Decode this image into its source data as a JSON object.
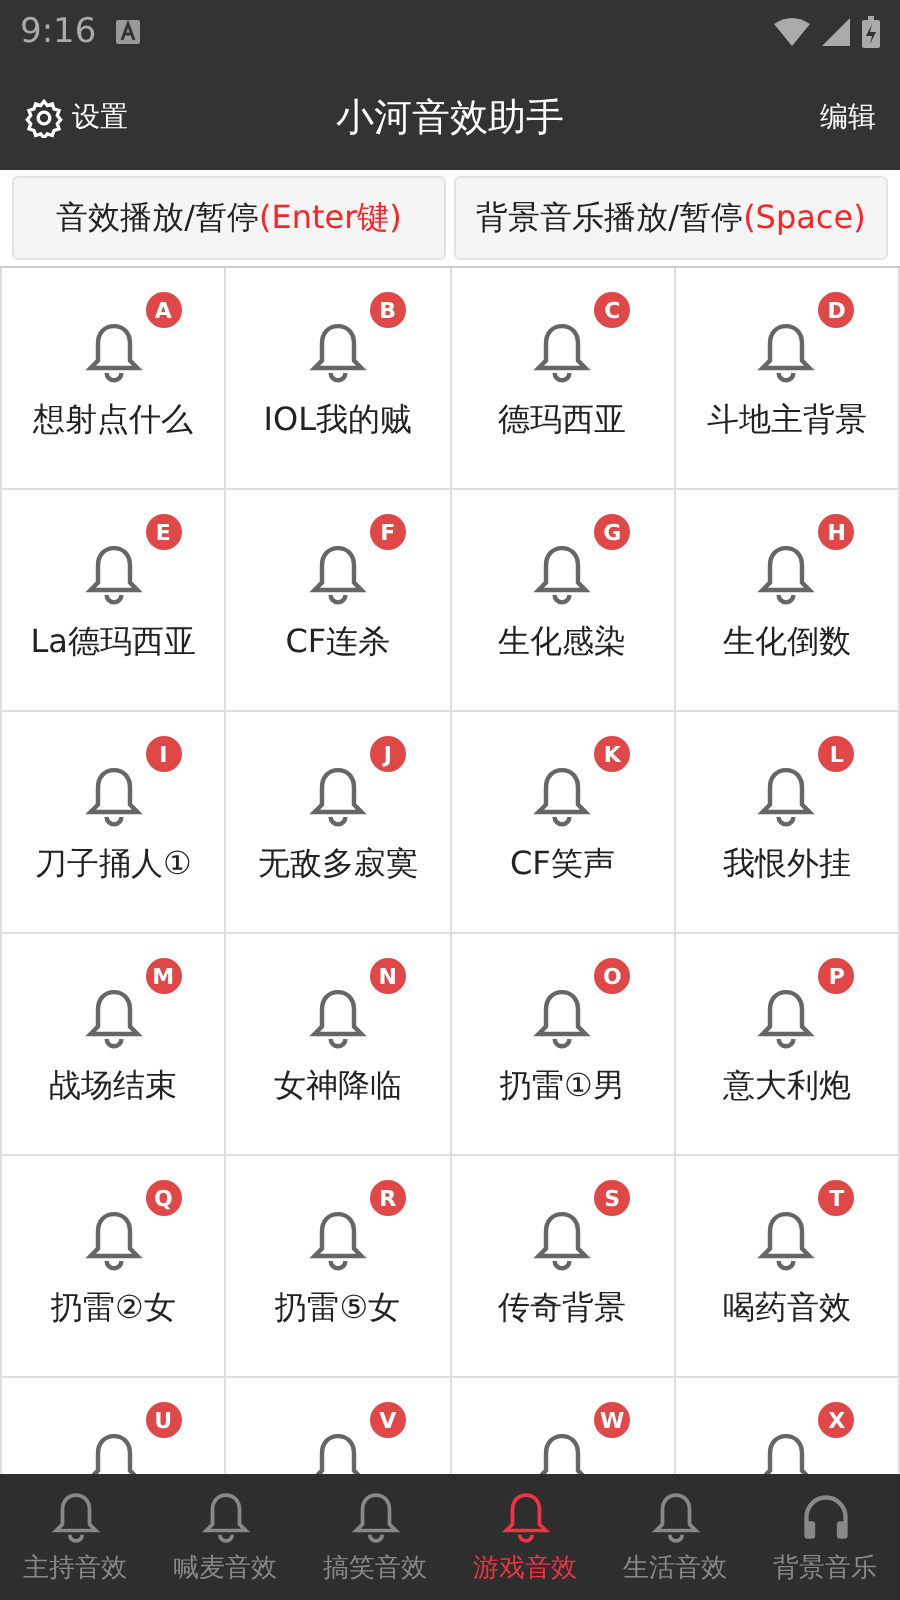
{
  "status_bar": {
    "time": "9:16"
  },
  "app_bar": {
    "settings": "设置",
    "title": "小河音效助手",
    "edit": "编辑"
  },
  "play_buttons": [
    {
      "label": "音效播放/暂停",
      "key": "(Enter键)"
    },
    {
      "label": "背景音乐播放/暂停",
      "key": "(Space)"
    }
  ],
  "sounds": [
    {
      "badge": "A",
      "label": "想射点什么"
    },
    {
      "badge": "B",
      "label": "IOL我的贼"
    },
    {
      "badge": "C",
      "label": "德玛西亚"
    },
    {
      "badge": "D",
      "label": "斗地主背景"
    },
    {
      "badge": "E",
      "label": "La德玛西亚"
    },
    {
      "badge": "F",
      "label": "CF连杀"
    },
    {
      "badge": "G",
      "label": "生化感染"
    },
    {
      "badge": "H",
      "label": "生化倒数"
    },
    {
      "badge": "I",
      "label": "刀子捅人①"
    },
    {
      "badge": "J",
      "label": "无敌多寂寞"
    },
    {
      "badge": "K",
      "label": "CF笑声"
    },
    {
      "badge": "L",
      "label": "我恨外挂"
    },
    {
      "badge": "M",
      "label": "战场结束"
    },
    {
      "badge": "N",
      "label": "女神降临"
    },
    {
      "badge": "O",
      "label": "扔雷①男"
    },
    {
      "badge": "P",
      "label": "意大利炮"
    },
    {
      "badge": "Q",
      "label": "扔雷②女"
    },
    {
      "badge": "R",
      "label": "扔雷⑤女"
    },
    {
      "badge": "S",
      "label": "传奇背景"
    },
    {
      "badge": "T",
      "label": "喝药音效"
    },
    {
      "badge": "U"
    },
    {
      "badge": "V"
    },
    {
      "badge": "W"
    },
    {
      "badge": "X"
    }
  ],
  "tabs": [
    {
      "label": "主持音效",
      "kind": "bell",
      "selected": false
    },
    {
      "label": "喊麦音效",
      "kind": "bell",
      "selected": false
    },
    {
      "label": "搞笑音效",
      "kind": "bell",
      "selected": false
    },
    {
      "label": "游戏音效",
      "kind": "bell",
      "selected": true
    },
    {
      "label": "生活音效",
      "kind": "bell",
      "selected": false
    },
    {
      "label": "背景音乐",
      "kind": "headphones",
      "selected": false
    }
  ]
}
